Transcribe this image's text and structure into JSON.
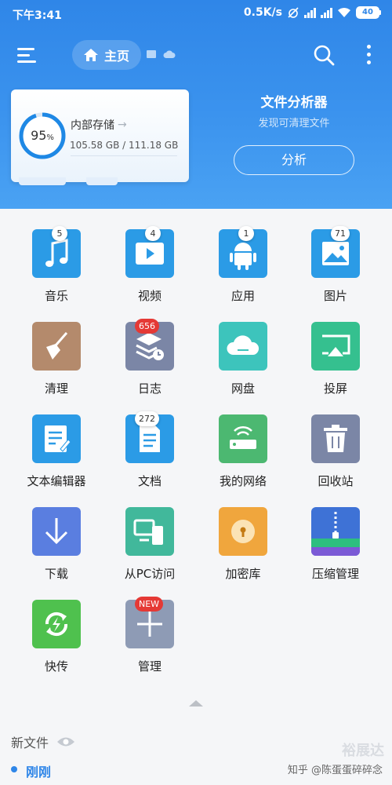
{
  "status_bar": {
    "time": "下午3:41",
    "speed": "0.5K/s",
    "battery": "40"
  },
  "toolbar": {
    "home_label": "主页"
  },
  "storage": {
    "percent": "95",
    "percent_sign": "%",
    "title": "内部存储",
    "size": "105.58 GB / 111.18 GB",
    "used_fraction": 0.95
  },
  "analyzer": {
    "title": "文件分析器",
    "subtitle": "发现可清理文件",
    "button": "分析"
  },
  "apps": [
    {
      "label": "音乐",
      "badge": "5",
      "badge_style": "white",
      "icon": "music-icon",
      "color": "#2b9be6"
    },
    {
      "label": "视频",
      "badge": "4",
      "badge_style": "white",
      "icon": "video-icon",
      "color": "#2b9be6"
    },
    {
      "label": "应用",
      "badge": "1",
      "badge_style": "white",
      "icon": "android-icon",
      "color": "#2b9be6"
    },
    {
      "label": "图片",
      "badge": "71",
      "badge_style": "white",
      "icon": "image-icon",
      "color": "#2b9be6"
    },
    {
      "label": "清理",
      "badge": "",
      "badge_style": "",
      "icon": "broom-icon",
      "color": "#b48a6c"
    },
    {
      "label": "日志",
      "badge": "656",
      "badge_style": "red",
      "icon": "log-icon",
      "color": "#7b86a6"
    },
    {
      "label": "网盘",
      "badge": "",
      "badge_style": "",
      "icon": "cloud-icon",
      "color": "#3dc4bc"
    },
    {
      "label": "投屏",
      "badge": "",
      "badge_style": "",
      "icon": "cast-icon",
      "color": "#35c08f"
    },
    {
      "label": "文本编辑器",
      "badge": "",
      "badge_style": "",
      "icon": "text-editor-icon",
      "color": "#2b9be6"
    },
    {
      "label": "文档",
      "badge": "272",
      "badge_style": "white",
      "icon": "document-icon",
      "color": "#2b9be6"
    },
    {
      "label": "我的网络",
      "badge": "",
      "badge_style": "",
      "icon": "router-icon",
      "color": "#4cb871"
    },
    {
      "label": "回收站",
      "badge": "",
      "badge_style": "",
      "icon": "trash-icon",
      "color": "#7b86a6"
    },
    {
      "label": "下载",
      "badge": "",
      "badge_style": "",
      "icon": "download-icon",
      "color": "#5a7ee0"
    },
    {
      "label": "从PC访问",
      "badge": "",
      "badge_style": "",
      "icon": "pc-access-icon",
      "color": "#41b89b"
    },
    {
      "label": "加密库",
      "badge": "",
      "badge_style": "",
      "icon": "lock-icon",
      "color": "#f0a63d"
    },
    {
      "label": "压缩管理",
      "badge": "",
      "badge_style": "",
      "icon": "archive-icon",
      "color": "#3e72d6"
    },
    {
      "label": "快传",
      "badge": "",
      "badge_style": "",
      "icon": "transfer-icon",
      "color": "#4fc14e"
    },
    {
      "label": "管理",
      "badge": "NEW",
      "badge_style": "red",
      "icon": "add-icon",
      "color": "#8e9bb5"
    }
  ],
  "recent": {
    "title": "新文件",
    "group": "刚刚"
  },
  "watermark": {
    "text": "知乎 @陈蛋蛋碎碎念",
    "logo": "裕展达"
  }
}
